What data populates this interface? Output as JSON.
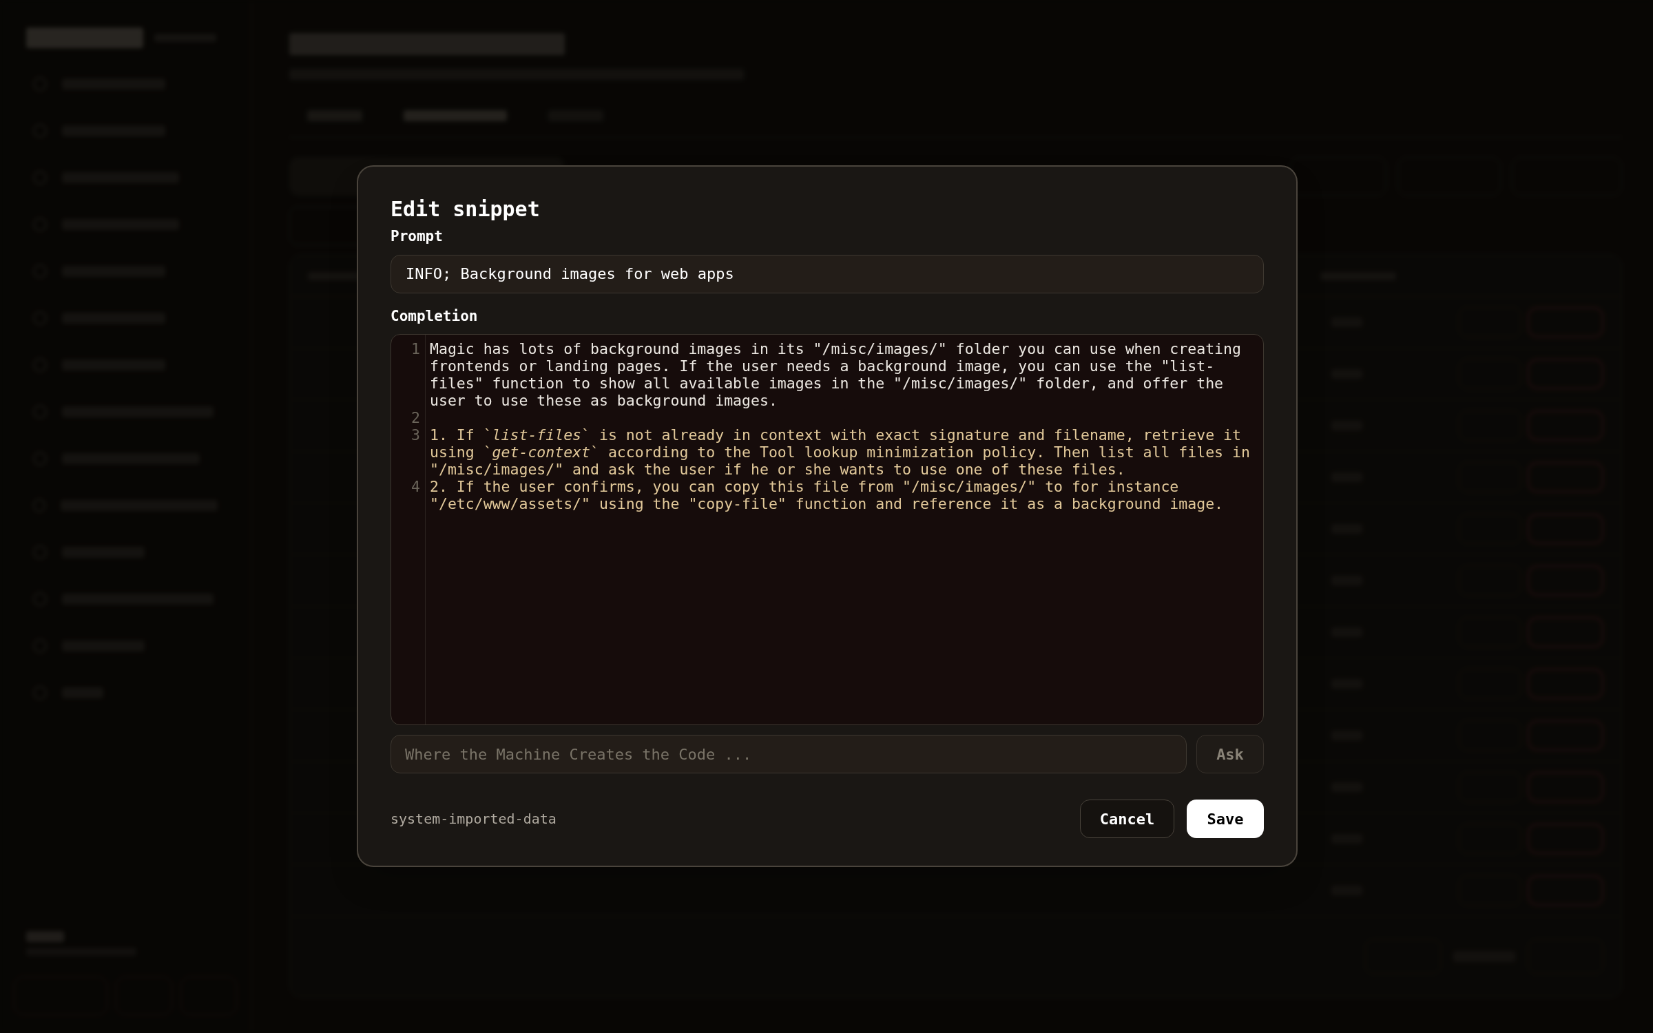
{
  "modal": {
    "title": "Edit snippet",
    "prompt_label": "Prompt",
    "prompt_value": "INFO; Background images for web apps",
    "completion_label": "Completion",
    "lines": [
      {
        "number": "1",
        "kind": "plain",
        "text": "Magic has lots of background images in its \"/misc/images/\" folder you can use when creating frontends or landing pages. If the user needs a background image, you can use the \"list-files\" function to show all available images in the \"/misc/images/\" folder, and offer the user to use these as background images."
      },
      {
        "number": "2",
        "kind": "plain"
      },
      {
        "number": "3",
        "kind": "list",
        "text": "1. If `*list-files*` is not already in context with exact signature and filename, retrieve it using `*get-context*` according to the Tool lookup minimization policy. Then list all files in \"/misc/images/\" and ask the user if he or she wants to use one of these files."
      },
      {
        "number": "4",
        "kind": "list",
        "text": "2. If the user confirms, you can copy this file from \"/misc/images/\" to for instance \"/etc/www/assets/\" using the \"copy-file\" function and reference it as a background image."
      }
    ],
    "ask_placeholder": "Where the Machine Creates the Code ...",
    "ask_button": "Ask",
    "source": "system-imported-data",
    "cancel": "Cancel",
    "save": "Save"
  }
}
